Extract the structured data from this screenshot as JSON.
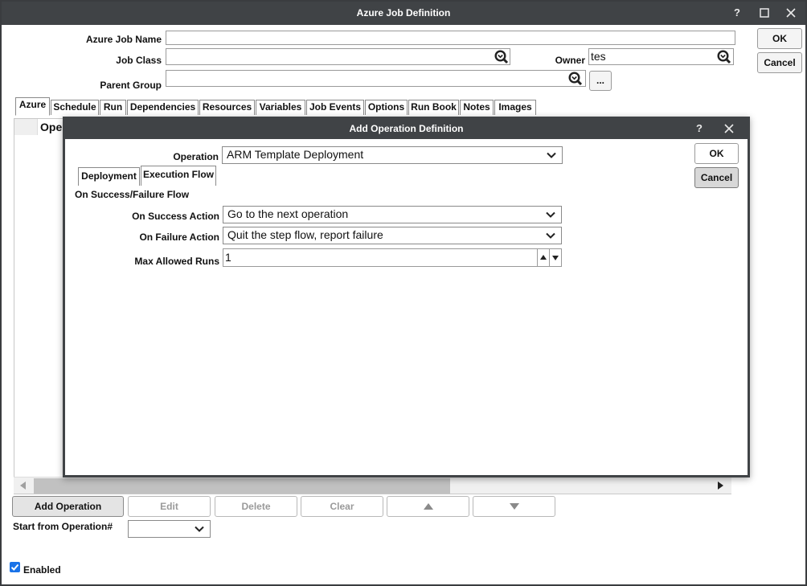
{
  "window": {
    "title": "Azure Job Definition",
    "help": "?",
    "ok_label": "OK",
    "cancel_label": "Cancel"
  },
  "form": {
    "job_name_label": "Azure Job Name",
    "job_name_value": "",
    "job_class_label": "Job Class",
    "job_class_value": "",
    "owner_label": "Owner",
    "owner_value": "tes",
    "parent_group_label": "Parent Group",
    "parent_group_value": "",
    "browse_label": "..."
  },
  "tabs": [
    "Azure",
    "Schedule",
    "Run",
    "Dependencies",
    "Resources",
    "Variables",
    "Job Events",
    "Options",
    "Run Book",
    "Notes",
    "Images"
  ],
  "grid": {
    "column_partial": "Ope"
  },
  "actions": {
    "add": "Add Operation",
    "edit": "Edit",
    "delete": "Delete",
    "clear": "Clear",
    "start_from_label": "Start from Operation#",
    "start_from_value": ""
  },
  "enabled": {
    "label": "Enabled",
    "checked": true
  },
  "modal": {
    "title": "Add Operation Definition",
    "help": "?",
    "operation_label": "Operation",
    "operation_value": "ARM Template Deployment",
    "ok_label": "OK",
    "cancel_label": "Cancel",
    "subtabs": [
      "Deployment",
      "Execution Flow"
    ],
    "section_title": "On Success/Failure Flow",
    "success_label": "On Success Action",
    "success_value": "Go to the next operation",
    "failure_label": "On Failure Action",
    "failure_value": "Quit the step flow, report failure",
    "max_runs_label": "Max Allowed Runs",
    "max_runs_value": "1"
  }
}
